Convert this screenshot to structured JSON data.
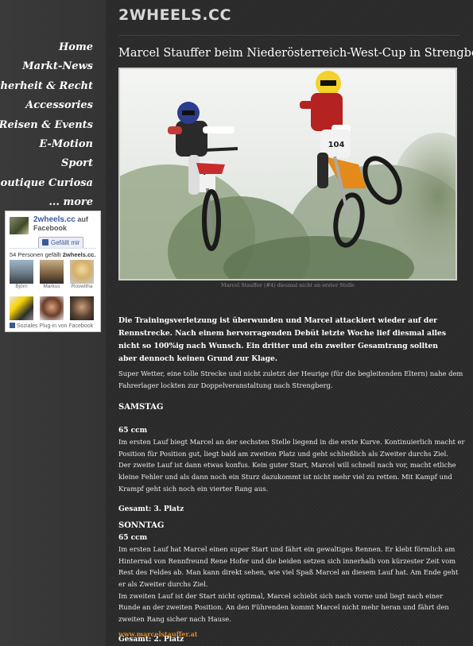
{
  "site": {
    "logo": "2WHEELS.CC"
  },
  "nav": [
    {
      "label": "Home"
    },
    {
      "label": "Markt-News"
    },
    {
      "label": "Sicherheit & Recht"
    },
    {
      "label": "Accessories"
    },
    {
      "label": "Reisen & Events"
    },
    {
      "label": "E-Motion"
    },
    {
      "label": "Sport"
    },
    {
      "label": "Boutique Curiosa"
    },
    {
      "label": "... more"
    }
  ],
  "facebook": {
    "page_name": "2wheels.cc",
    "on_label": "auf",
    "platform": "Facebook",
    "like_button": "Gefällt mir",
    "count_prefix": "54 Personen gefällt",
    "count_page": "2wheels.cc.",
    "faces": [
      {
        "name": "Björn"
      },
      {
        "name": "Markus"
      },
      {
        "name": "Roswitha"
      },
      {
        "name": ""
      },
      {
        "name": ""
      },
      {
        "name": ""
      }
    ],
    "footer": "Soziales Plug-in von Facebook"
  },
  "article": {
    "title": "Marcel Stauffer beim Niederösterreich-West-Cup in Strengberg",
    "caption": "Marcel Stauffer (#4) diesmal nicht an erster Stelle",
    "lead": "Die Trainingsverletzung ist überwunden und Marcel attackiert wieder auf der Rennstrecke. Nach einem hervorragenden Debüt letzte Woche lief diesmal alles nicht so 100%ig nach Wunsch. Ein dritter und ein zweiter Gesamtrang sollten aber dennoch keinen Grund zur Klage.",
    "intro": "Super Wetter, eine tolle Strecke und nicht zuletzt der Heurige (für die begleitenden Eltern) nahe dem Fahrerlager lockten zur Doppelveranstaltung nach Strengberg.",
    "samstag": {
      "heading": "SAMSTAG",
      "class": "65 ccm",
      "p1": "Im ersten Lauf biegt Marcel an der sechsten Stelle liegend in die erste Kurve. Kontinuierlich macht er Position für Position gut, liegt bald am zweiten Platz und geht schließlich als Zweiter durchs Ziel.",
      "p2": "Der zweite Lauf ist dann etwas konfus. Kein guter Start, Marcel will schnell nach vor, macht etliche kleine Fehler und als dann noch ein Sturz dazukommt ist nicht mehr viel zu retten. Mit Kampf und Krampf geht sich noch ein vierter Rang aus.",
      "result": "Gesamt: 3. Platz"
    },
    "sonntag": {
      "heading": "SONNTAG",
      "class": "65 ccm",
      "p1": "Im ersten Lauf hat Marcel einen super Start und fährt ein gewaltiges Rennen. Er klebt förmlich am Hinterrad von Rennfreund Rene Hofer und die beiden setzen sich innerhalb von kürzester Zeit vom Rest des Feldes ab. Man kann direkt sehen, wie viel Spaß Marcel an diesem Lauf hat. Am Ende geht er als Zweiter durchs Ziel.",
      "p2": "Im zweiten Lauf ist der Start nicht optimal, Marcel schiebt sich nach vorne und liegt nach einer Runde an der zweiten Position. An den Führenden kommt Marcel nicht mehr heran und fährt den zweiten Rang sicher nach Hause.",
      "result": "Gesamt: 2. Platz"
    },
    "link": "www.marcelstauffer.at",
    "bike_numbers": [
      "4",
      "104"
    ]
  },
  "colors": {
    "link": "#d98c2b",
    "facebook": "#3b5998"
  }
}
